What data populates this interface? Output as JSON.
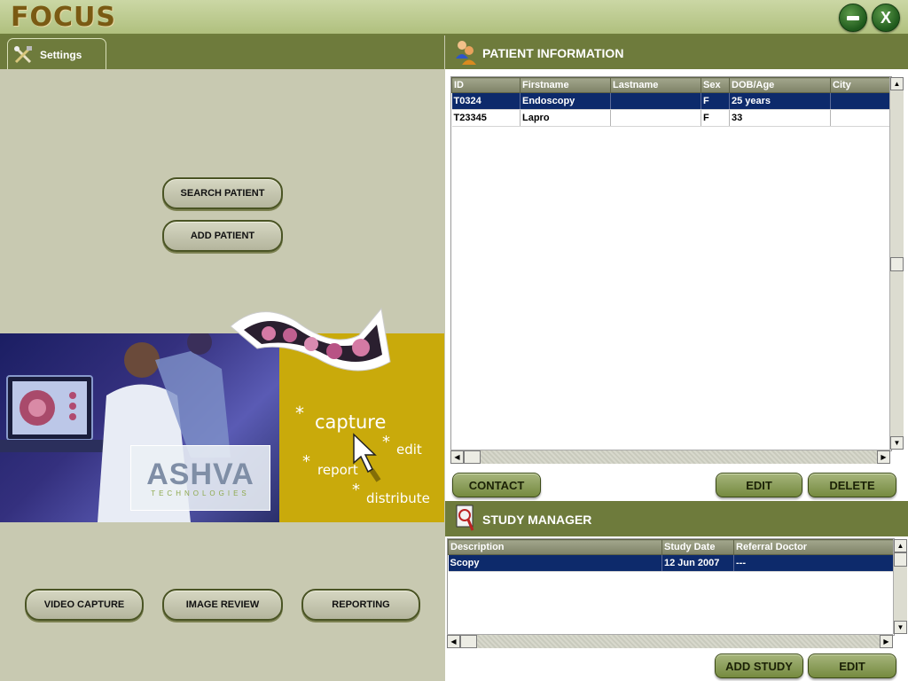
{
  "app": {
    "logo": "FOCUS"
  },
  "window": {
    "minimize_icon": "minimize-icon",
    "close_label": "X"
  },
  "settings_tab": {
    "label": "Settings",
    "icon": "tools-icon"
  },
  "left": {
    "search_patient": "SEARCH PATIENT",
    "add_patient": "ADD PATIENT",
    "video_capture": "VIDEO CAPTURE",
    "image_review": "IMAGE REVIEW",
    "reporting": "REPORTING"
  },
  "banner": {
    "brand": "ASHVA",
    "brand_sub": "TECHNOLOGIES",
    "words": {
      "capture": "capture",
      "edit": "edit",
      "report": "report",
      "distribute": "distribute"
    },
    "accent_color": "#c9aa0b"
  },
  "patient": {
    "title": "PATIENT INFORMATION",
    "icon": "patients-icon",
    "columns": [
      "ID",
      "Firstname",
      "Lastname",
      "Sex",
      "DOB/Age",
      "City"
    ],
    "rows": [
      {
        "id": "T0324",
        "firstname": "Endoscopy",
        "lastname": "",
        "sex": "F",
        "dob_age": "25 years",
        "city": "",
        "selected": true
      },
      {
        "id": "T23345",
        "firstname": "Lapro",
        "lastname": "",
        "sex": "F",
        "dob_age": "33",
        "city": "",
        "selected": false
      }
    ],
    "contact": "CONTACT",
    "edit": "EDIT",
    "delete": "DELETE"
  },
  "study": {
    "title": "STUDY MANAGER",
    "icon": "study-search-icon",
    "columns": [
      "Description",
      "Study Date",
      "Referral Doctor"
    ],
    "rows": [
      {
        "description": "Scopy",
        "study_date": "12 Jun 2007",
        "referral_doctor": "---",
        "selected": true
      }
    ],
    "add_study": "ADD STUDY",
    "edit": "EDIT"
  },
  "colors": {
    "header_green": "#6e7b3c",
    "panel_bg": "#c8c9b1",
    "selection": "#0d2a6b"
  }
}
